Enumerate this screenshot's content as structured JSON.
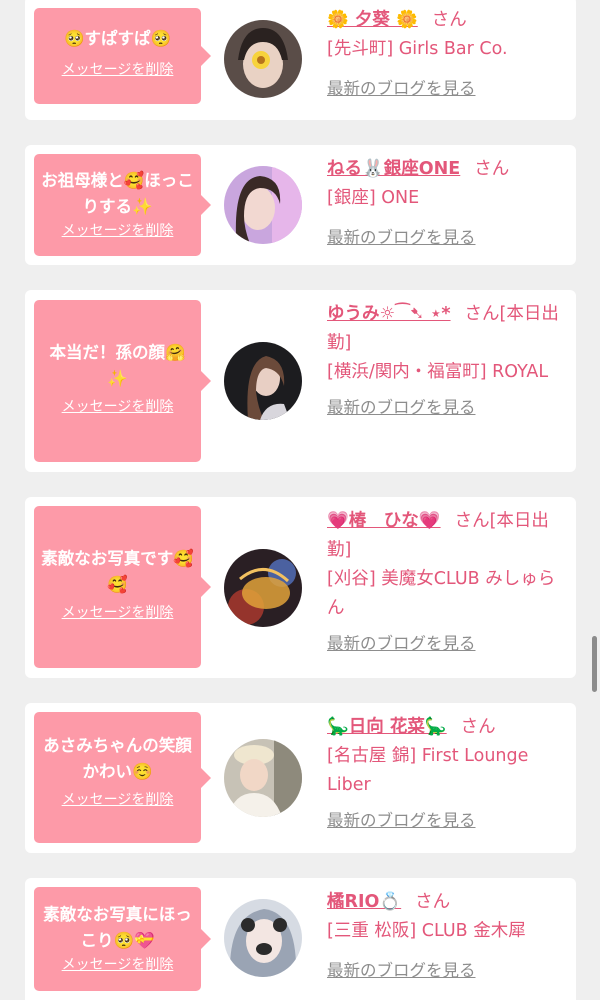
{
  "cards": [
    {
      "message": "🥺すぱすぱ🥺",
      "delete_label": "メッセージを削除",
      "name": "🌼 夕葵 🌼",
      "honorific": "さん",
      "shop": "[先斗町] Girls Bar Co.",
      "blog_label": "最新のブログを見る"
    },
    {
      "message": "お祖母様と🥰ほっこりする✨",
      "delete_label": "メッセージを削除",
      "name": "ねる🐰銀座ONE",
      "honorific": "さん",
      "shop": "[銀座] ONE",
      "blog_label": "最新のブログを見る"
    },
    {
      "message": "本当だ！孫の顔🤗✨",
      "delete_label": "メッセージを削除",
      "name": "ゆうみ☼⁀➷ ⋆*",
      "honorific": "さん[本日出勤]",
      "shop": "[横浜/関内・福富町] ROYAL",
      "blog_label": "最新のブログを見る"
    },
    {
      "message": "素敵なお写真です🥰🥰",
      "delete_label": "メッセージを削除",
      "name": "💗椿　ひな💗",
      "honorific": "さん[本日出勤]",
      "shop": "[刈谷] 美魔女CLUB みしゅらん",
      "blog_label": "最新のブログを見る"
    },
    {
      "message": "あさみちゃんの笑顔かわい☺️",
      "delete_label": "メッセージを削除",
      "name": "🦕日向 花菜🦕",
      "honorific": "さん",
      "shop": "[名古屋 錦] First Lounge Liber",
      "blog_label": "最新のブログを見る"
    },
    {
      "message": "素敵なお写真にほっこり🥺💝",
      "delete_label": "メッセージを削除",
      "name": "橘RIO💍",
      "honorific": "さん",
      "shop": "[三重 松阪] CLUB 金木犀",
      "blog_label": "最新のブログを見る"
    }
  ],
  "colors": {
    "background": "#efefef",
    "card": "#ffffff",
    "bubble": "#fd9aa8",
    "accent_text": "#e3577a",
    "muted_link": "#8d8d8d"
  }
}
